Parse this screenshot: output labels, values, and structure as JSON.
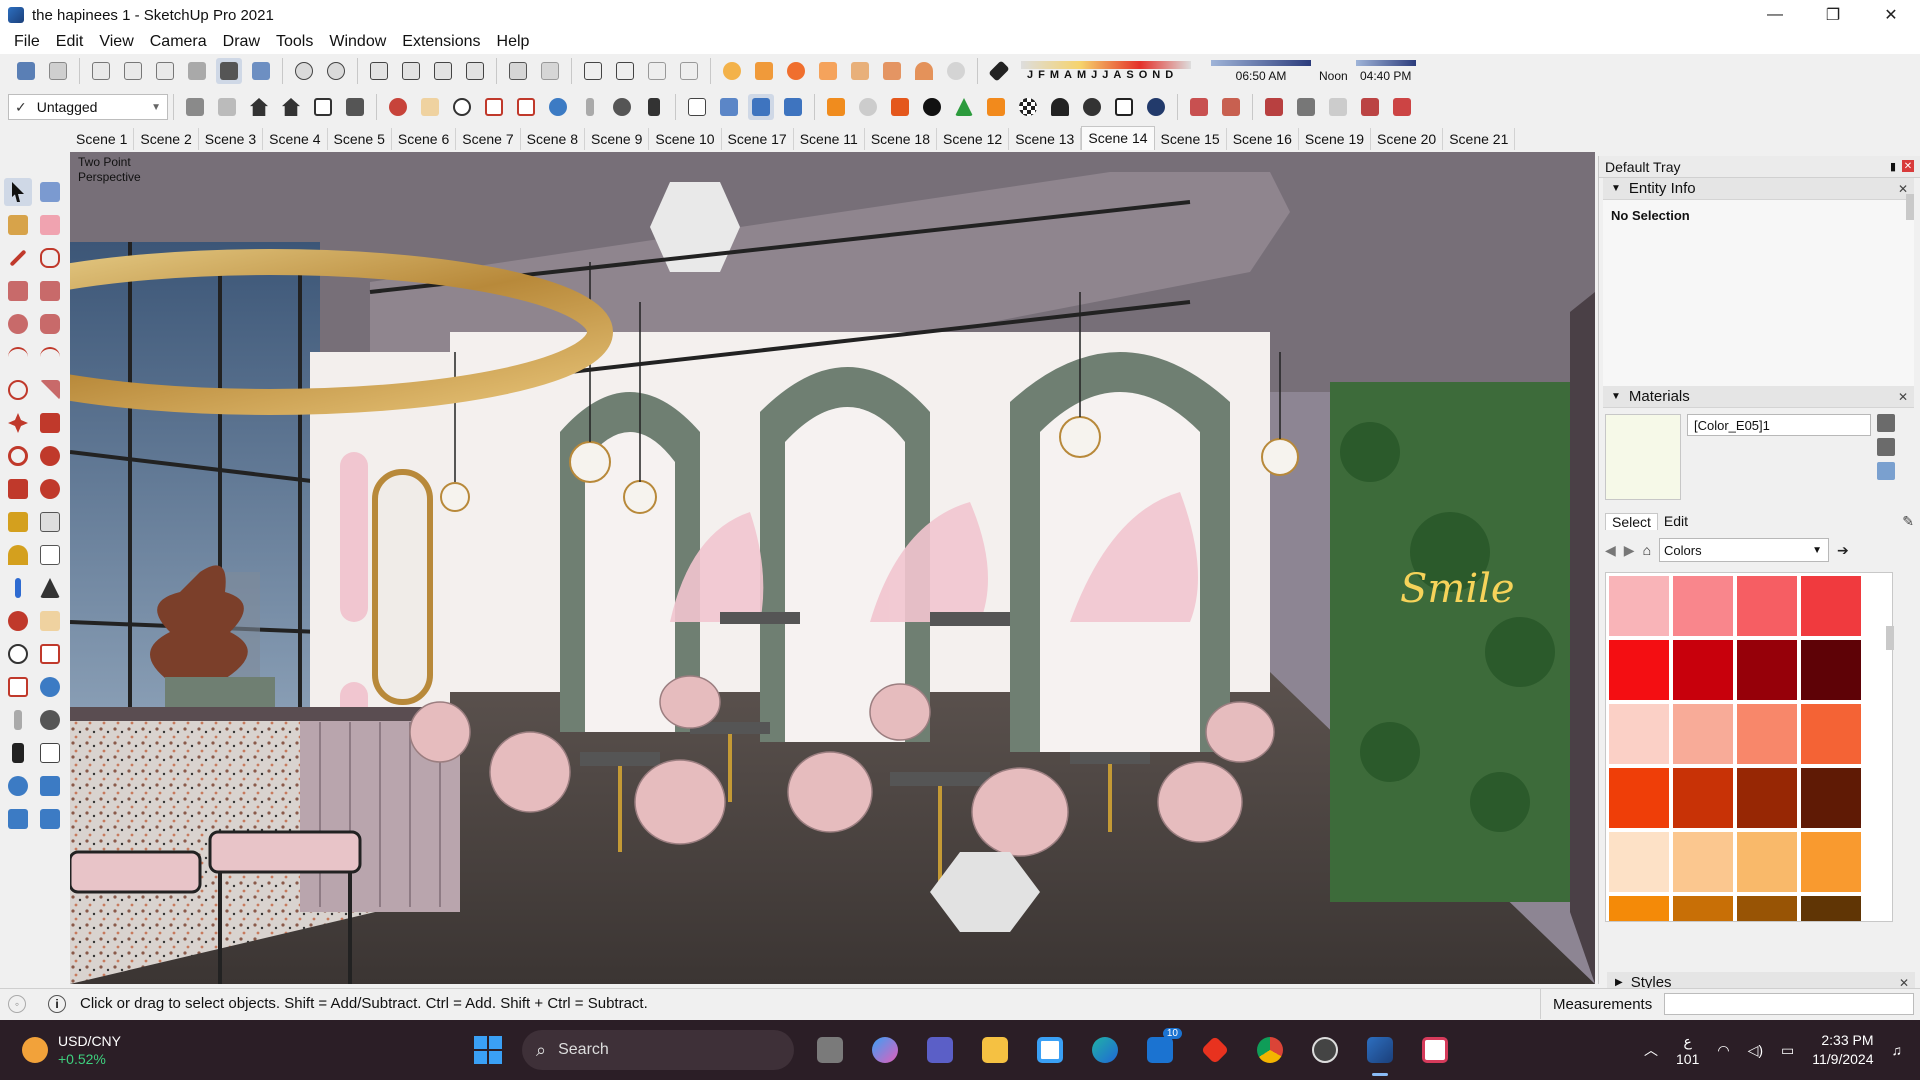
{
  "window": {
    "title": "the hapinees 1 - SketchUp Pro 2021",
    "minimize": "—",
    "maximize": "❐",
    "close": "✕"
  },
  "menu": [
    "File",
    "Edit",
    "View",
    "Camera",
    "Draw",
    "Tools",
    "Window",
    "Extensions",
    "Help"
  ],
  "toolbar": {
    "tag_value": "Untagged",
    "months": [
      "J",
      "F",
      "M",
      "A",
      "M",
      "J",
      "J",
      "A",
      "S",
      "O",
      "N",
      "D"
    ],
    "time_start": "06:50 AM",
    "time_noon": "Noon",
    "time_end": "04:40 PM"
  },
  "scenes": [
    "Scene 1",
    "Scene 2",
    "Scene 3",
    "Scene 4",
    "Scene 5",
    "Scene 6",
    "Scene 7",
    "Scene 8",
    "Scene 9",
    "Scene 10",
    "Scene 17",
    "Scene 11",
    "Scene 18",
    "Scene 12",
    "Scene 13",
    "Scene 14",
    "Scene 15",
    "Scene 16",
    "Scene 19",
    "Scene 20",
    "Scene 21"
  ],
  "active_scene": "Scene 14",
  "viewport": {
    "perspective_label": "Two Point\nPerspective",
    "sign_text": "Smile"
  },
  "tray": {
    "title": "Default Tray",
    "entity_info": {
      "title": "Entity Info",
      "selection": "No Selection"
    },
    "materials": {
      "title": "Materials",
      "current_name": "[Color_E05]1",
      "current_color": "#f6f9e8",
      "tab_select": "Select",
      "tab_edit": "Edit",
      "library": "Colors",
      "swatches": [
        "#f9b4b8",
        "#f9868c",
        "#f65e63",
        "#f03a3e",
        "#f40e12",
        "#c8000c",
        "#960009",
        "#5e0206",
        "#fbd0c6",
        "#f8ab98",
        "#f8876a",
        "#f46335",
        "#ef3e08",
        "#c83206",
        "#972704",
        "#5f1a05",
        "#fde1c6",
        "#fbc78f",
        "#f9b96a",
        "#f99a2f",
        "#f48a08",
        "#c86f06",
        "#985405",
        "#603505"
      ]
    },
    "styles": {
      "title": "Styles"
    }
  },
  "status": {
    "message": "Click or drag to select objects. Shift = Add/Subtract. Ctrl = Add. Shift + Ctrl = Subtract.",
    "measurements_label": "Measurements"
  },
  "taskbar": {
    "ticker_name": "USD/CNY",
    "ticker_change": "+0.52%",
    "search_placeholder": "Search",
    "mail_badge": "10",
    "weather_icon": "ع",
    "weather_value": "101",
    "time": "2:33 PM",
    "date": "11/9/2024"
  }
}
